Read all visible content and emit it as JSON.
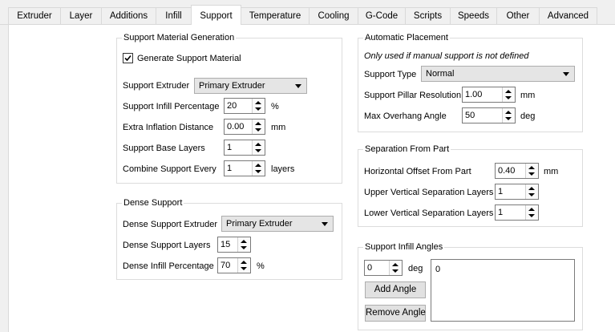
{
  "tabs": [
    {
      "label": "Extruder"
    },
    {
      "label": "Layer"
    },
    {
      "label": "Additions"
    },
    {
      "label": "Infill"
    },
    {
      "label": "Support",
      "active": true
    },
    {
      "label": "Temperature"
    },
    {
      "label": "Cooling"
    },
    {
      "label": "G-Code"
    },
    {
      "label": "Scripts"
    },
    {
      "label": "Speeds"
    },
    {
      "label": "Other"
    },
    {
      "label": "Advanced"
    }
  ],
  "support_material_generation": {
    "title": "Support Material Generation",
    "generate_support_label": "Generate Support Material",
    "generate_support_checked": true,
    "support_extruder_label": "Support Extruder",
    "support_extruder_value": "Primary Extruder",
    "infill_percentage_label": "Support Infill Percentage",
    "infill_percentage_value": "20",
    "infill_percentage_unit": "%",
    "inflation_label": "Extra Inflation Distance",
    "inflation_value": "0.00",
    "inflation_unit": "mm",
    "base_layers_label": "Support Base Layers",
    "base_layers_value": "1",
    "combine_label": "Combine Support Every",
    "combine_value": "1",
    "combine_unit": "layers"
  },
  "dense_support": {
    "title": "Dense Support",
    "extruder_label": "Dense Support Extruder",
    "extruder_value": "Primary Extruder",
    "layers_label": "Dense Support Layers",
    "layers_value": "15",
    "infill_label": "Dense Infill Percentage",
    "infill_value": "70",
    "infill_unit": "%"
  },
  "automatic_placement": {
    "title": "Automatic Placement",
    "note": "Only used if manual support is not defined",
    "type_label": "Support Type",
    "type_value": "Normal",
    "pillar_label": "Support Pillar Resolution",
    "pillar_value": "1.00",
    "pillar_unit": "mm",
    "overhang_label": "Max Overhang Angle",
    "overhang_value": "50",
    "overhang_unit": "deg"
  },
  "separation": {
    "title": "Separation From Part",
    "horizontal_label": "Horizontal Offset From Part",
    "horizontal_value": "0.40",
    "horizontal_unit": "mm",
    "upper_label": "Upper Vertical Separation Layers",
    "upper_value": "1",
    "lower_label": "Lower Vertical Separation Layers",
    "lower_value": "1"
  },
  "infill_angles": {
    "title": "Support Infill Angles",
    "angle_value": "0",
    "angle_unit": "deg",
    "add_label": "Add Angle",
    "remove_label": "Remove Angle",
    "list_items": [
      "0"
    ]
  }
}
